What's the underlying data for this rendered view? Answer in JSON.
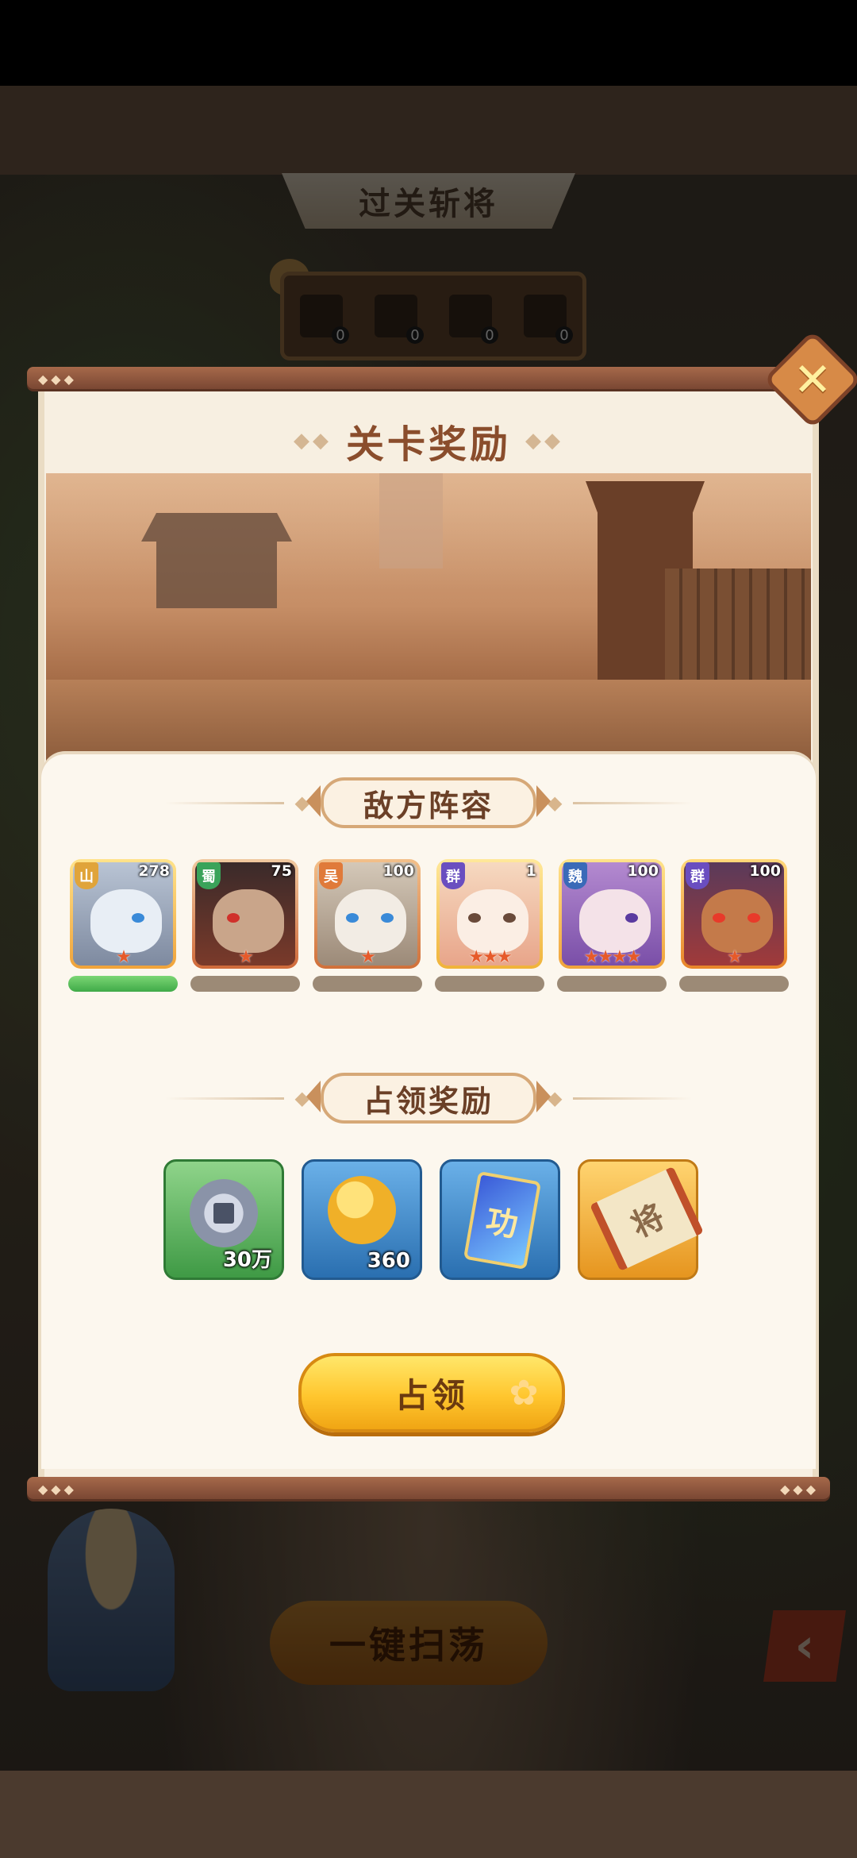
{
  "background": {
    "stage_title": "过关斩将",
    "kill_counters": [
      "0",
      "0",
      "0",
      "0"
    ],
    "sweep_label": "一键扫荡",
    "back_glyph": "‹"
  },
  "modal": {
    "title": "关卡奖励",
    "close_glyph": "✕",
    "enemy_section_title": "敌方阵容",
    "reward_section_title": "占领奖励",
    "occupy_label": "占领"
  },
  "enemies": [
    {
      "faction": "山",
      "level": "278",
      "stars": "★",
      "hp": 1.0
    },
    {
      "faction": "蜀",
      "level": "75",
      "stars": "★",
      "hp": 0.0
    },
    {
      "faction": "吴",
      "level": "100",
      "stars": "★",
      "hp": 0.0
    },
    {
      "faction": "群",
      "level": "1",
      "stars": "★★★",
      "hp": 0.0
    },
    {
      "faction": "魏",
      "level": "100",
      "stars": "★★★★",
      "hp": 0.0
    },
    {
      "faction": "群",
      "level": "100",
      "stars": "★",
      "hp": 0.0
    }
  ],
  "rewards": [
    {
      "name": "copper-coin",
      "amount": "30万",
      "color": "#4fa84f"
    },
    {
      "name": "gold-coin",
      "amount": "360",
      "color": "#3b87c7"
    },
    {
      "name": "merit-card",
      "amount": "",
      "label": "功",
      "color": "#3b87c7"
    },
    {
      "name": "general-scroll",
      "amount": "",
      "label": "将",
      "color": "#e9a12a"
    }
  ],
  "colors": {
    "accent_brown": "#8a4d2c",
    "button_yellow": "#ffc62e"
  }
}
